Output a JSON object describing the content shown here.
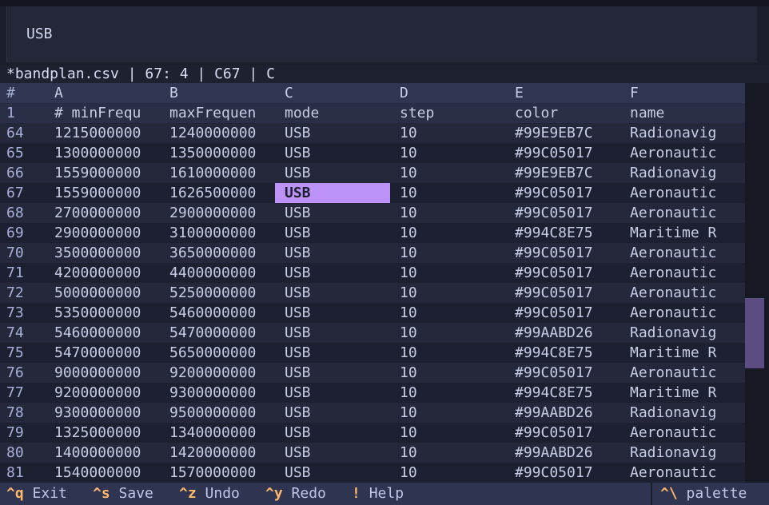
{
  "editor": {
    "value": "USB"
  },
  "status": {
    "text": "*bandplan.csv | 67: 4 | C67 | C"
  },
  "columns": [
    "#",
    "A",
    "B",
    "C",
    "D",
    "E",
    "F"
  ],
  "header_row": [
    "1",
    "# minFrequ",
    "maxFrequen",
    "mode",
    "step",
    "color",
    "name"
  ],
  "rows": [
    [
      "64",
      "1215000000",
      "1240000000",
      "USB",
      "10",
      "#99E9EB7C",
      "Radionavig"
    ],
    [
      "65",
      "1300000000",
      "1350000000",
      "USB",
      "10",
      "#99C05017",
      "Aeronautic"
    ],
    [
      "66",
      "1559000000",
      "1610000000",
      "USB",
      "10",
      "#99E9EB7C",
      "Radionavig"
    ],
    [
      "67",
      "1559000000",
      "1626500000",
      "USB",
      "10",
      "#99C05017",
      "Aeronautic"
    ],
    [
      "68",
      "2700000000",
      "2900000000",
      "USB",
      "10",
      "#99C05017",
      "Aeronautic"
    ],
    [
      "69",
      "2900000000",
      "3100000000",
      "USB",
      "10",
      "#994C8E75",
      "Maritime R"
    ],
    [
      "70",
      "3500000000",
      "3650000000",
      "USB",
      "10",
      "#99C05017",
      "Aeronautic"
    ],
    [
      "71",
      "4200000000",
      "4400000000",
      "USB",
      "10",
      "#99C05017",
      "Aeronautic"
    ],
    [
      "72",
      "5000000000",
      "5250000000",
      "USB",
      "10",
      "#99C05017",
      "Aeronautic"
    ],
    [
      "73",
      "5350000000",
      "5460000000",
      "USB",
      "10",
      "#99C05017",
      "Aeronautic"
    ],
    [
      "74",
      "5460000000",
      "5470000000",
      "USB",
      "10",
      "#99AABD26",
      "Radionavig"
    ],
    [
      "75",
      "5470000000",
      "5650000000",
      "USB",
      "10",
      "#994C8E75",
      "Maritime R"
    ],
    [
      "76",
      "9000000000",
      "9200000000",
      "USB",
      "10",
      "#99C05017",
      "Aeronautic"
    ],
    [
      "77",
      "9200000000",
      "9300000000",
      "USB",
      "10",
      "#994C8E75",
      "Maritime R"
    ],
    [
      "78",
      "9300000000",
      "9500000000",
      "USB",
      "10",
      "#99AABD26",
      "Radionavig"
    ],
    [
      "79",
      "1325000000",
      "1340000000",
      "USB",
      "10",
      "#99C05017",
      "Aeronautic"
    ],
    [
      "80",
      "1400000000",
      "1420000000",
      "USB",
      "10",
      "#99AABD26",
      "Radionavig"
    ],
    [
      "81",
      "1540000000",
      "1570000000",
      "USB",
      "10",
      "#99C05017",
      "Aeronautic"
    ]
  ],
  "selected": {
    "row": "67",
    "column": "C"
  },
  "footer": {
    "exit_key": "^q",
    "exit_label": "Exit",
    "save_key": "^s",
    "save_label": "Save",
    "undo_key": "^z",
    "undo_label": "Undo",
    "redo_key": "^y",
    "redo_label": "Redo",
    "help_key": "!",
    "help_label": "Help",
    "palette_key": "^\\",
    "palette_label": "palette"
  },
  "colors": {
    "background": "#1b1e2b",
    "selection": "#bd93f9",
    "key": "#ffb86c",
    "scroll_thumb": "#5b4d82"
  }
}
